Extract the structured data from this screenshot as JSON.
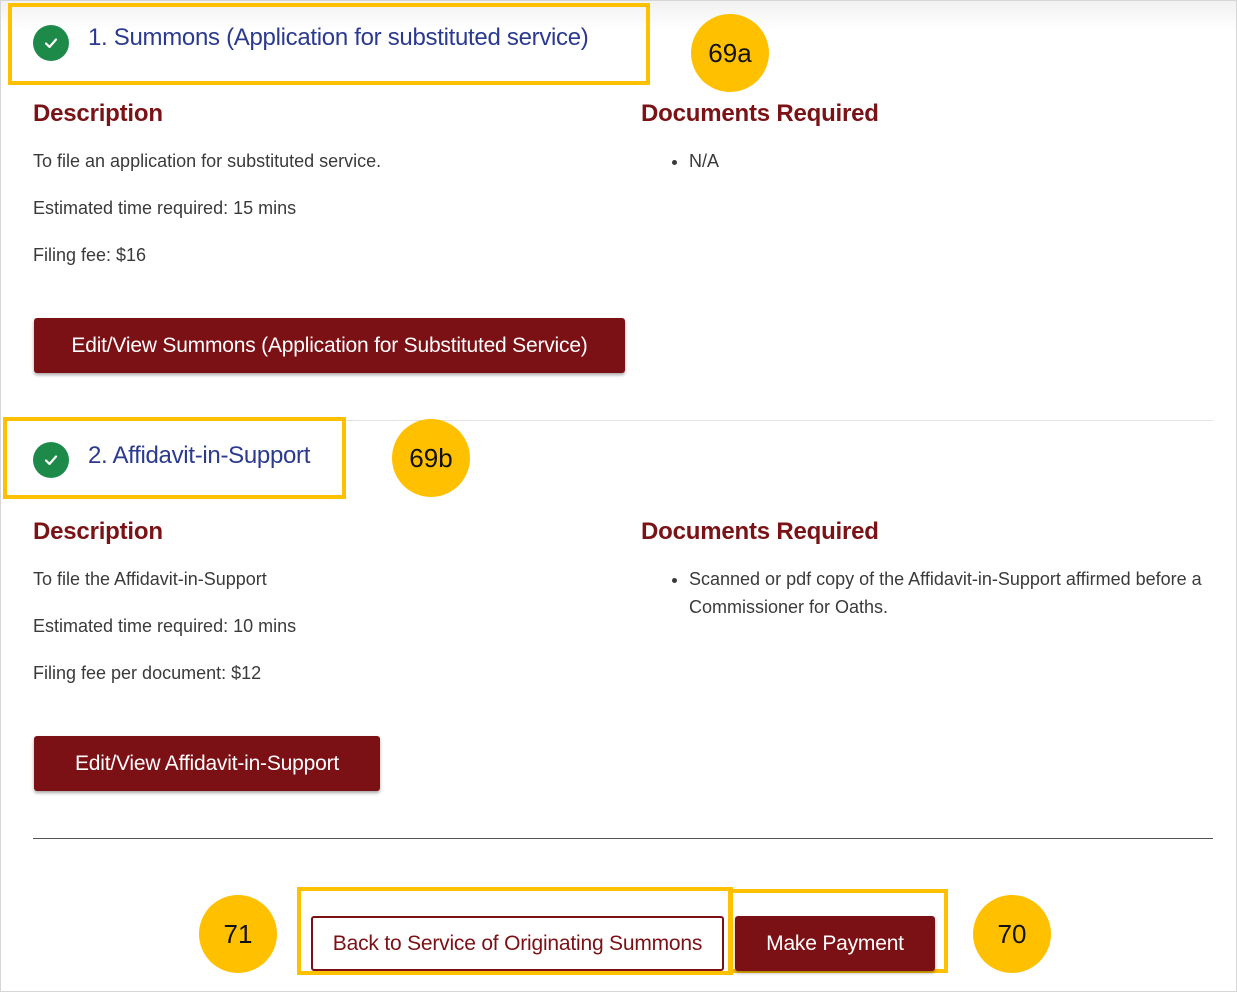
{
  "steps": [
    {
      "title": "1. Summons (Application for substituted service)",
      "description_heading": "Description",
      "description": "To file an application for substituted service.",
      "estimated_time": "Estimated time required: 15 mins",
      "fee": "Filing fee: $16",
      "documents_heading": "Documents Required",
      "documents": [
        "N/A"
      ],
      "button_label": "Edit/View Summons (Application for Substituted Service)",
      "callout": "69a"
    },
    {
      "title": "2. Affidavit-in-Support",
      "description_heading": "Description",
      "description": "To file the Affidavit-in-Support",
      "estimated_time": "Estimated time required: 10 mins",
      "fee": "Filing fee per document: $12",
      "documents_heading": "Documents Required",
      "documents": [
        "Scanned or pdf copy of the Affidavit-in-Support affirmed before a Commissioner for Oaths."
      ],
      "button_label": "Edit/View Affidavit-in-Support",
      "callout": "69b"
    }
  ],
  "footer": {
    "back_label": "Back to Service of Originating Summons",
    "pay_label": "Make Payment",
    "back_callout": "71",
    "pay_callout": "70"
  },
  "colors": {
    "step_title": "#2b3a8f",
    "heading": "#7a1216",
    "button": "#7b1015",
    "check": "#1e8a49",
    "highlight": "#ffc000"
  },
  "icons": {
    "step_status": "check-circle-icon"
  }
}
